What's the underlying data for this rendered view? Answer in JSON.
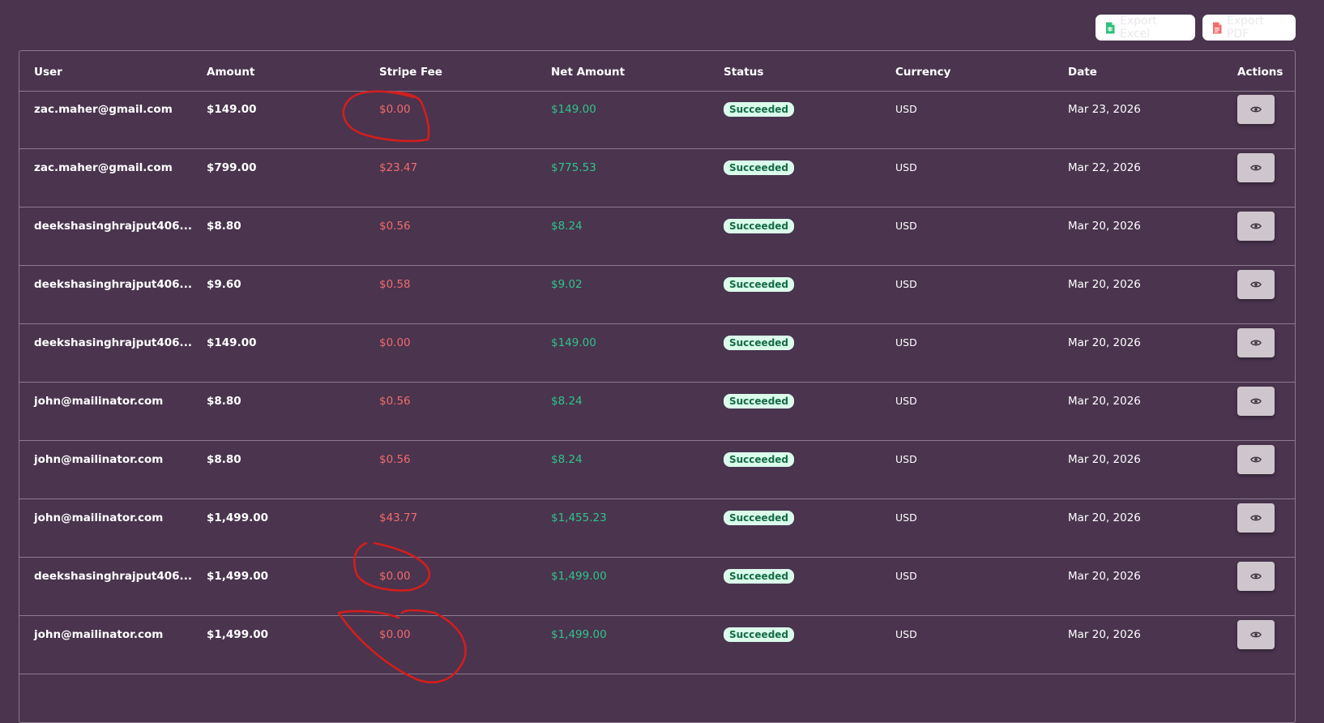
{
  "toolbar": {
    "export_excel_label": "Export Excel",
    "export_pdf_label": "Export PDF"
  },
  "table": {
    "columns": [
      "User",
      "Amount",
      "Stripe Fee",
      "Net Amount",
      "Status",
      "Currency",
      "Date",
      "Actions"
    ],
    "rows": [
      {
        "user": "zac.maher@gmail.com",
        "amount": "$149.00",
        "fee": "$0.00",
        "net": "$149.00",
        "status": "Succeeded",
        "currency": "USD",
        "date": "Mar 23, 2026"
      },
      {
        "user": "zac.maher@gmail.com",
        "amount": "$799.00",
        "fee": "$23.47",
        "net": "$775.53",
        "status": "Succeeded",
        "currency": "USD",
        "date": "Mar 22, 2026"
      },
      {
        "user": "deekshasinghrajput406...",
        "amount": "$8.80",
        "fee": "$0.56",
        "net": "$8.24",
        "status": "Succeeded",
        "currency": "USD",
        "date": "Mar 20, 2026"
      },
      {
        "user": "deekshasinghrajput406...",
        "amount": "$9.60",
        "fee": "$0.58",
        "net": "$9.02",
        "status": "Succeeded",
        "currency": "USD",
        "date": "Mar 20, 2026"
      },
      {
        "user": "deekshasinghrajput406...",
        "amount": "$149.00",
        "fee": "$0.00",
        "net": "$149.00",
        "status": "Succeeded",
        "currency": "USD",
        "date": "Mar 20, 2026"
      },
      {
        "user": "john@mailinator.com",
        "amount": "$8.80",
        "fee": "$0.56",
        "net": "$8.24",
        "status": "Succeeded",
        "currency": "USD",
        "date": "Mar 20, 2026"
      },
      {
        "user": "john@mailinator.com",
        "amount": "$8.80",
        "fee": "$0.56",
        "net": "$8.24",
        "status": "Succeeded",
        "currency": "USD",
        "date": "Mar 20, 2026"
      },
      {
        "user": "john@mailinator.com",
        "amount": "$1,499.00",
        "fee": "$43.77",
        "net": "$1,455.23",
        "status": "Succeeded",
        "currency": "USD",
        "date": "Mar 20, 2026"
      },
      {
        "user": "deekshasinghrajput406...",
        "amount": "$1,499.00",
        "fee": "$0.00",
        "net": "$1,499.00",
        "status": "Succeeded",
        "currency": "USD",
        "date": "Mar 20, 2026"
      },
      {
        "user": "john@mailinator.com",
        "amount": "$1,499.00",
        "fee": "$0.00",
        "net": "$1,499.00",
        "status": "Succeeded",
        "currency": "USD",
        "date": "Mar 20, 2026"
      }
    ]
  },
  "icons": {
    "export_excel": "spreadsheet-file-icon",
    "export_pdf": "pdf-file-icon",
    "view": "eye-icon"
  },
  "colors": {
    "background": "#4a344e",
    "border": "#8b7b8d",
    "fee_text": "#f26c6c",
    "net_text": "#2fc48a",
    "status_bg": "#dbfbeb",
    "status_text": "#136b44",
    "view_button": "#cfc6cd",
    "annotation": "#d21e1e"
  }
}
